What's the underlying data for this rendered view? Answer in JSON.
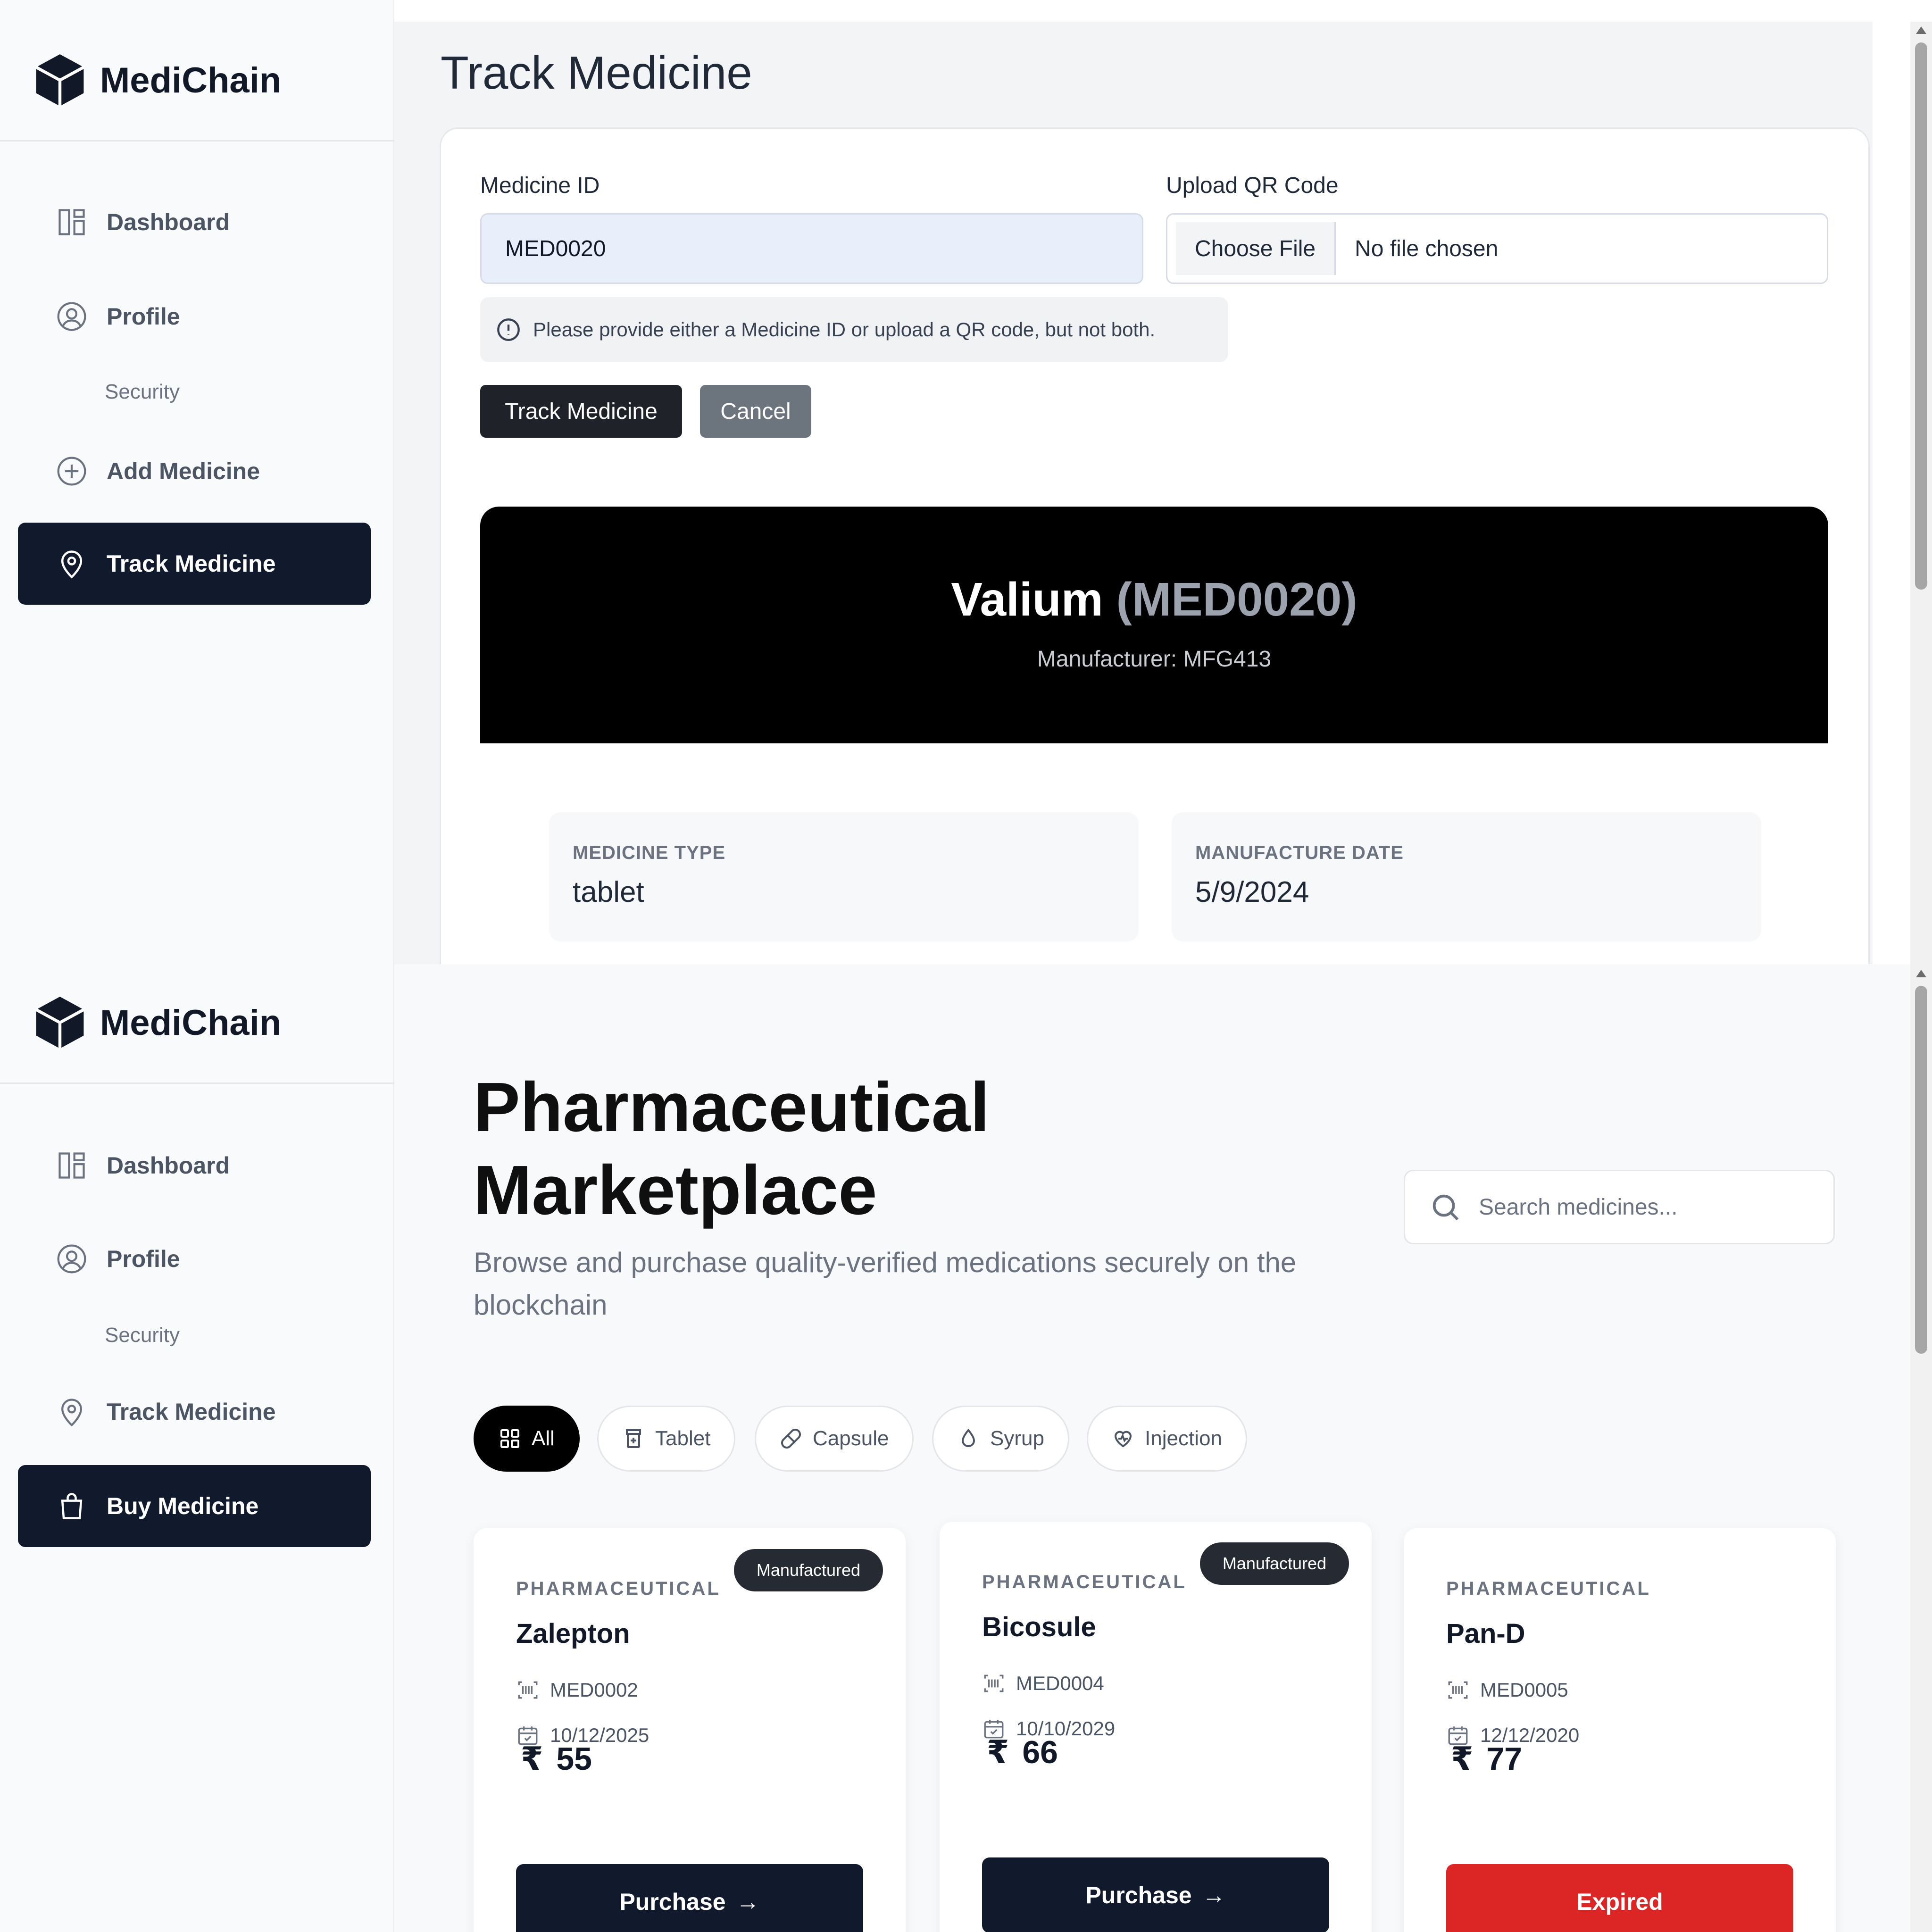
{
  "top": {
    "brand": "MediChain",
    "nav": {
      "dashboard": "Dashboard",
      "profile": "Profile",
      "security": "Security",
      "add_medicine": "Add Medicine",
      "track_medicine": "Track Medicine"
    },
    "page_title": "Track Medicine",
    "form": {
      "medicine_id_label": "Medicine ID",
      "medicine_id_value": "MED0020",
      "qr_label": "Upload QR Code",
      "choose_file": "Choose File",
      "no_file": "No file chosen",
      "hint": "Please provide either a Medicine ID or upload a QR code, but not both.",
      "track_button": "Track Medicine",
      "cancel_button": "Cancel"
    },
    "result": {
      "name": "Valium",
      "id_display": "(MED0020)",
      "manufacturer": "Manufacturer: MFG413",
      "type_label": "MEDICINE TYPE",
      "type_value": "tablet",
      "date_label": "MANUFACTURE DATE",
      "date_value": "5/9/2024"
    }
  },
  "bottom": {
    "brand": "MediChain",
    "nav": {
      "dashboard": "Dashboard",
      "profile": "Profile",
      "security": "Security",
      "track_medicine": "Track Medicine",
      "buy_medicine": "Buy Medicine"
    },
    "title_line1": "Pharmaceutical",
    "title_line2": "Marketplace",
    "subtitle": "Browse and purchase quality-verified medications securely on the blockchain",
    "search_placeholder": "Search medicines...",
    "filters": [
      "All",
      "Tablet",
      "Capsule",
      "Syrup",
      "Injection"
    ],
    "currency": "₹",
    "products": [
      {
        "category": "PHARMACEUTICAL",
        "badge": "Manufactured",
        "name": "Zalepton",
        "id": "MED0002",
        "date": "10/12/2025",
        "price": "55",
        "action": "Purchase"
      },
      {
        "category": "PHARMACEUTICAL",
        "badge": "Manufactured",
        "name": "Bicosule",
        "id": "MED0004",
        "date": "10/10/2029",
        "price": "66",
        "action": "Purchase"
      },
      {
        "category": "PHARMACEUTICAL",
        "badge": "",
        "name": "Pan-D",
        "id": "MED0005",
        "date": "12/12/2020",
        "price": "77",
        "action": "Expired"
      }
    ],
    "colors": {
      "primary": "#111a2c",
      "expired": "#dc2626",
      "badge": "#262b33"
    }
  }
}
